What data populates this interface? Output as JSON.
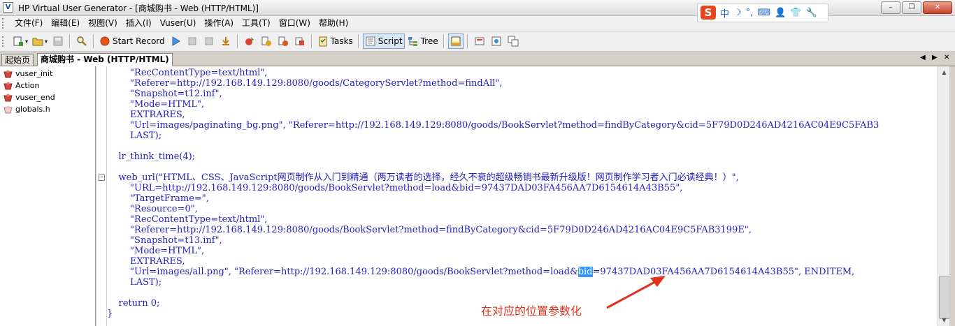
{
  "window": {
    "title": "HP Virtual User Generator - [商城购书 - Web (HTTP/HTML)]",
    "app_icon_glyph": "V",
    "buttons": [
      "minimize",
      "restore",
      "close"
    ]
  },
  "ime": {
    "logo": "S",
    "items": [
      "中",
      "☽",
      "°,",
      "⌨",
      "👤",
      "👕",
      "🔧"
    ]
  },
  "menu": {
    "items": [
      "文件(F)",
      "编辑(E)",
      "视图(V)",
      "插入(I)",
      "Vuser(U)",
      "操作(A)",
      "工具(T)",
      "窗口(W)",
      "帮助(H)"
    ]
  },
  "toolbar": {
    "start_record": "Start Record",
    "tasks": "Tasks",
    "script": "Script",
    "tree": "Tree"
  },
  "tabs": {
    "start_page": "起始页",
    "script_tab": "商城购书 - Web (HTTP/HTML)",
    "nav": [
      "◀",
      "▶",
      "✕"
    ]
  },
  "tree": {
    "items": [
      "vuser_init",
      "Action",
      "vuser_end",
      "globals.h"
    ]
  },
  "code": {
    "lines": [
      "        \"RecContentType=text/html\",",
      "        \"Referer=http://192.168.149.129:8080/goods/CategoryServlet?method=findAll\",",
      "        \"Snapshot=t12.inf\",",
      "        \"Mode=HTML\",",
      "        EXTRARES,",
      "        \"Url=images/paginating_bg.png\", \"Referer=http://192.168.149.129:8080/goods/BookServlet?method=findByCategory&cid=5F79D0D246AD4216AC04E9C5FAB3",
      "        LAST);",
      "",
      "    lr_think_time(4);",
      "",
      "    web_url(\"HTML、CSS、JavaScript网页制作从入门到精通（两万读者的选择，经久不衰的超级畅销书最新升级版！网页制作学习者入门必读经典！）\",",
      "        \"URL=http://192.168.149.129:8080/goods/BookServlet?method=load&bid=97437DAD03FA456AA7D6154614A43B55\",",
      "        \"TargetFrame=\",",
      "        \"Resource=0\",",
      "        \"RecContentType=text/html\",",
      "        \"Referer=http://192.168.149.129:8080/goods/BookServlet?method=findByCategory&cid=5F79D0D246AD4216AC04E9C5FAB3199E\",",
      "        \"Snapshot=t13.inf\",",
      "        \"Mode=HTML\",",
      "        EXTRARES,",
      "        \"Url=images/all.png\", \"Referer=http://192.168.149.129:8080/goods/BookServlet?method=load&",
      "        LAST);",
      "",
      "    return 0;",
      "}"
    ],
    "line19_selected": "bid",
    "line19_rest": "=97437DAD03FA456AA7D6154614A43B55\", ENDITEM,"
  },
  "annotation": {
    "text": "在对应的位置参数化",
    "color": "#e0331f"
  },
  "colors": {
    "code_text": "#1f1fbd",
    "selection": "#3399ff",
    "arrow": "#e0331f"
  }
}
